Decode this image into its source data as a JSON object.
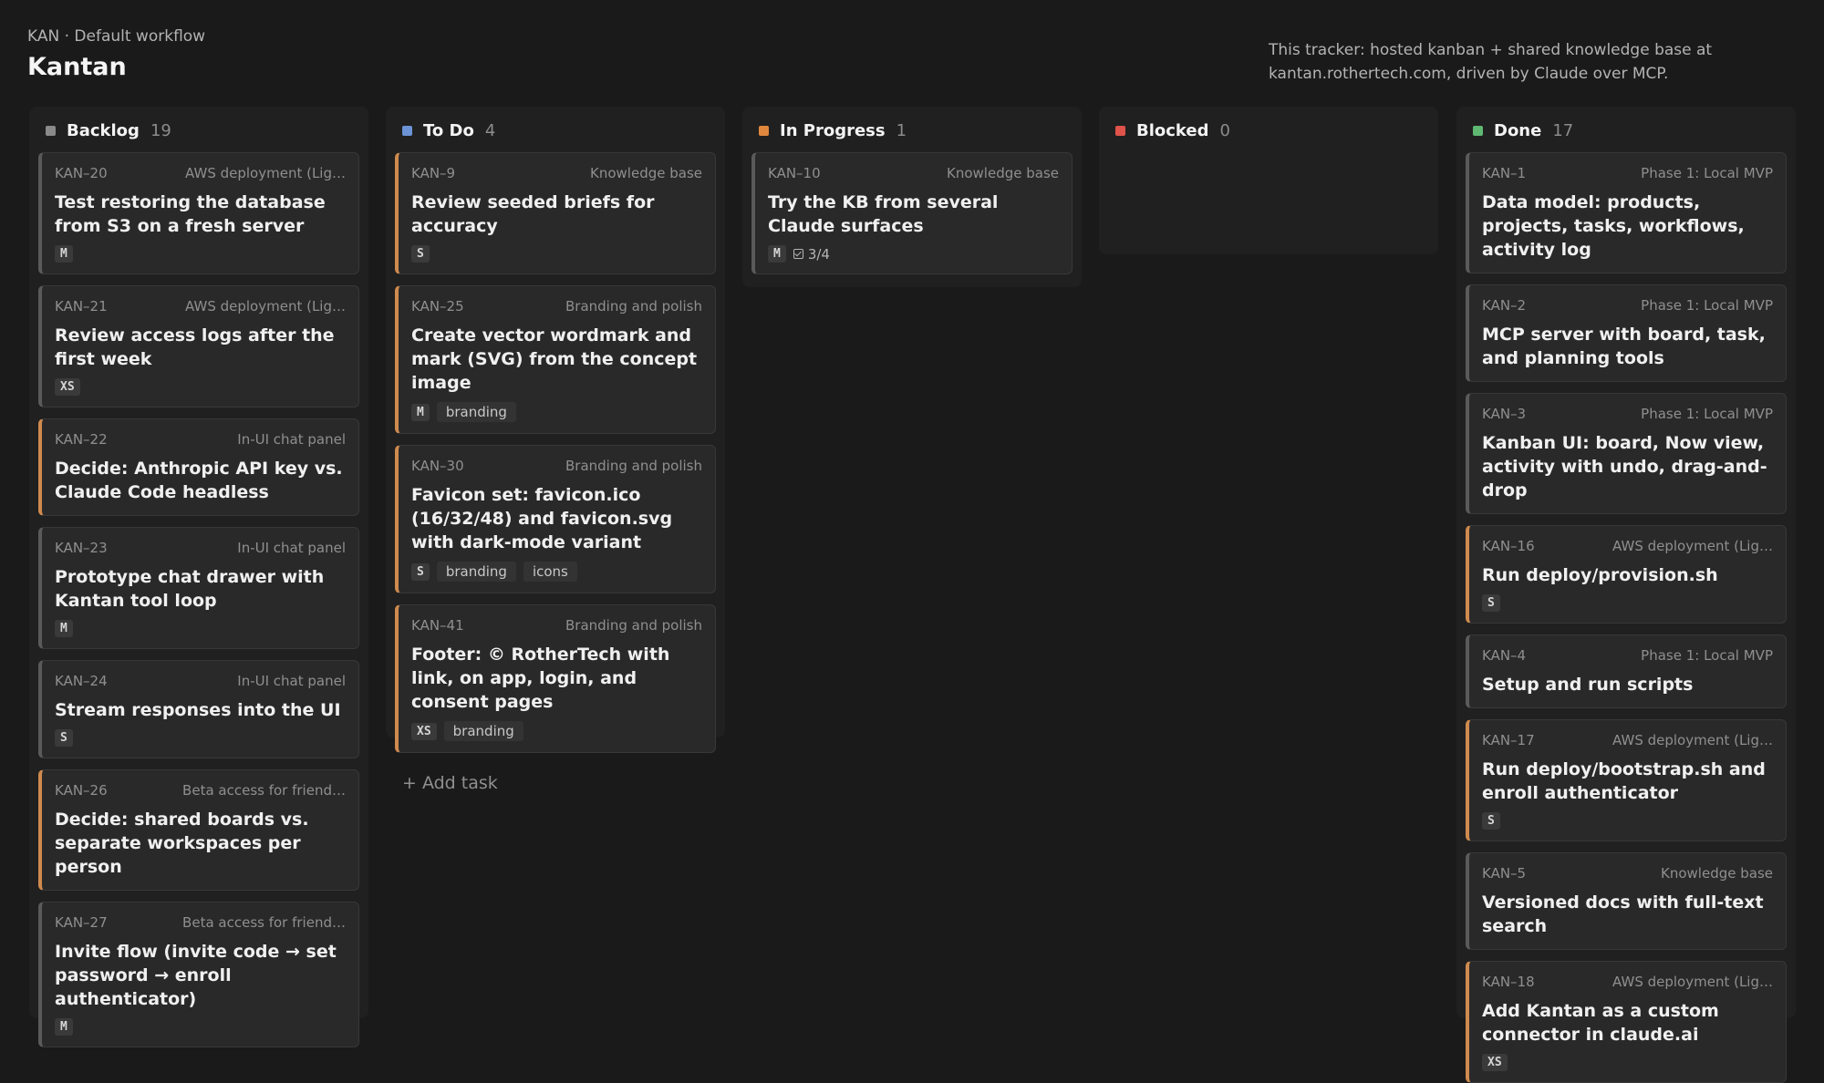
{
  "header": {
    "breadcrumb": "KAN · Default workflow",
    "title": "Kantan"
  },
  "info": "This tracker: hosted kanban + shared knowledge base at kantan.rothertech.com, driven by Claude over MCP.",
  "colors": {
    "backlog": "#8a8a8a",
    "todo": "#6b93d6",
    "in_progress": "#e0873e",
    "blocked": "#e0534a",
    "done": "#5fb872",
    "accent_border": "#cf8a4e"
  },
  "columns": [
    {
      "name": "Backlog",
      "count": "19",
      "cards": [
        {
          "key": "KAN–20",
          "project": "AWS deployment (Lig…",
          "title": "Test restoring the database from S3 on a fresh server",
          "size": "M"
        },
        {
          "key": "KAN–21",
          "project": "AWS deployment (Lig…",
          "title": "Review access logs after the first week",
          "size": "XS"
        },
        {
          "key": "KAN–22",
          "project": "In-UI chat panel",
          "title": "Decide: Anthropic API key vs. Claude Code headless"
        },
        {
          "key": "KAN–23",
          "project": "In-UI chat panel",
          "title": "Prototype chat drawer with Kantan tool loop",
          "size": "M"
        },
        {
          "key": "KAN–24",
          "project": "In-UI chat panel",
          "title": "Stream responses into the UI",
          "size": "S"
        },
        {
          "key": "KAN–26",
          "project": "Beta access for friend…",
          "title": "Decide: shared boards vs. separate workspaces per person"
        },
        {
          "key": "KAN–27",
          "project": "Beta access for friend…",
          "title": "Invite flow (invite code → set password → enroll authenticator)",
          "size": "M"
        }
      ]
    },
    {
      "name": "To Do",
      "count": "4",
      "cards": [
        {
          "key": "KAN–9",
          "project": "Knowledge base",
          "title": "Review seeded briefs for accuracy",
          "size": "S"
        },
        {
          "key": "KAN–25",
          "project": "Branding and polish",
          "title": "Create vector wordmark and mark (SVG) from the concept image",
          "size": "M",
          "labels": [
            "branding"
          ]
        },
        {
          "key": "KAN–30",
          "project": "Branding and polish",
          "title": "Favicon set: favicon.ico (16/32/48) and favicon.svg with dark-mode variant",
          "size": "S",
          "labels": [
            "branding",
            "icons"
          ]
        },
        {
          "key": "KAN–41",
          "project": "Branding and polish",
          "title": "Footer: © RotherTech with link, on app, login, and consent pages",
          "size": "XS",
          "labels": [
            "branding"
          ]
        }
      ],
      "add_task": "+ Add task"
    },
    {
      "name": "In Progress",
      "count": "1",
      "cards": [
        {
          "key": "KAN–10",
          "project": "Knowledge base",
          "title": "Try the KB from several Claude surfaces",
          "size": "M",
          "progress": "3/4"
        }
      ]
    },
    {
      "name": "Blocked",
      "count": "0",
      "cards": []
    },
    {
      "name": "Done",
      "count": "17",
      "cards": [
        {
          "key": "KAN–1",
          "project": "Phase 1: Local MVP",
          "title": "Data model: products, projects, tasks, workflows, activity log"
        },
        {
          "key": "KAN–2",
          "project": "Phase 1: Local MVP",
          "title": "MCP server with board, task, and planning tools"
        },
        {
          "key": "KAN–3",
          "project": "Phase 1: Local MVP",
          "title": "Kanban UI: board, Now view, activity with undo, drag-and-drop"
        },
        {
          "key": "KAN–16",
          "project": "AWS deployment (Lig…",
          "title": "Run deploy/provision.sh",
          "size": "S"
        },
        {
          "key": "KAN–4",
          "project": "Phase 1: Local MVP",
          "title": "Setup and run scripts"
        },
        {
          "key": "KAN–17",
          "project": "AWS deployment (Lig…",
          "title": "Run deploy/bootstrap.sh and enroll authenticator",
          "size": "S"
        },
        {
          "key": "KAN–5",
          "project": "Knowledge base",
          "title": "Versioned docs with full-text search"
        },
        {
          "key": "KAN–18",
          "project": "AWS deployment (Lig…",
          "title": "Add Kantan as a custom connector in claude.ai",
          "size": "XS"
        }
      ]
    }
  ]
}
